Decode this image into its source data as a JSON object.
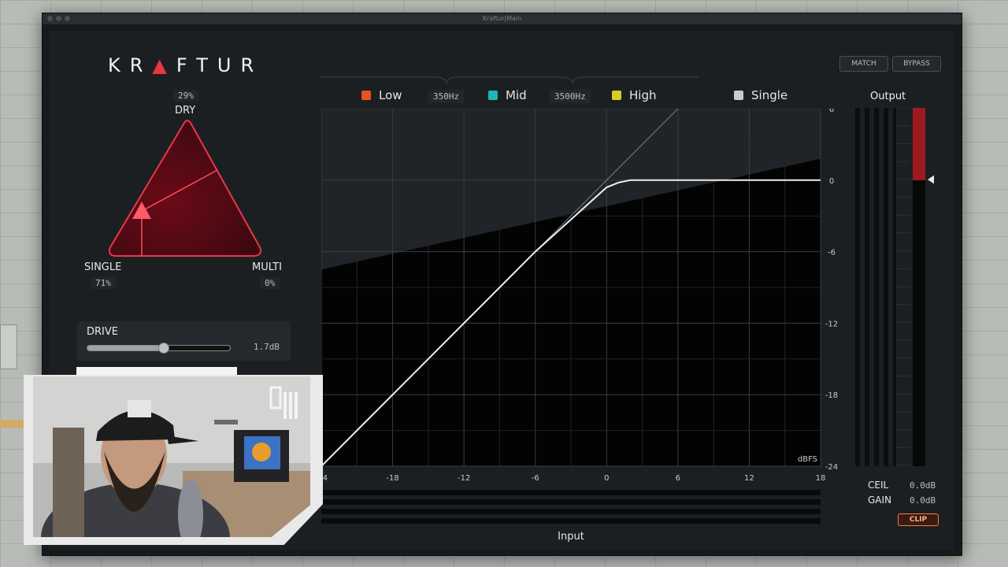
{
  "window": {
    "title": "Kraftur|Main"
  },
  "logo": {
    "pre": "KR",
    "mark": "Λ",
    "post": "FTUR"
  },
  "top_buttons": {
    "match": "MATCH",
    "bypass": "BYPASS"
  },
  "triangle": {
    "dry_label": "DRY",
    "dry_value": "29%",
    "single_label": "SINGLE",
    "single_value": "71%",
    "multi_label": "MULTI",
    "multi_value": "0%"
  },
  "drive": {
    "label": "DRIVE",
    "value": "1.7dB",
    "level": 0.53
  },
  "bands": {
    "low": {
      "label": "Low",
      "color": "#e8531f"
    },
    "low_mid_freq": "350Hz",
    "mid": {
      "label": "Mid",
      "color": "#1fb7b5"
    },
    "mid_high_freq": "3500Hz",
    "high": {
      "label": "High",
      "color": "#d8cf20"
    },
    "single": {
      "label": "Single",
      "color": "#c9cbcd"
    }
  },
  "chart_data": {
    "type": "line",
    "x_ticks": [
      "-24",
      "-18",
      "-12",
      "-6",
      "0",
      "6",
      "12",
      "18"
    ],
    "y_ticks": [
      "6",
      "0",
      "-6",
      "-12",
      "-18",
      "-24"
    ],
    "xlim": [
      -24,
      18
    ],
    "ylim": [
      -24,
      6
    ],
    "unit_label": "dBFS",
    "xlabel": "Input",
    "curve": [
      [
        -24,
        -24
      ],
      [
        -6,
        -6
      ],
      [
        0,
        -0.6
      ],
      [
        1,
        -0.2
      ],
      [
        2,
        0
      ],
      [
        18,
        0
      ]
    ],
    "reference": [
      [
        -24,
        -24
      ],
      [
        6,
        6
      ]
    ]
  },
  "output": {
    "title": "Output",
    "ceil_label": "CEIL",
    "ceil_value": "0.0dB",
    "gain_label": "GAIN",
    "gain_value": "0.0dB",
    "clip_label": "CLIP",
    "meter_color": "#9c1b22"
  }
}
